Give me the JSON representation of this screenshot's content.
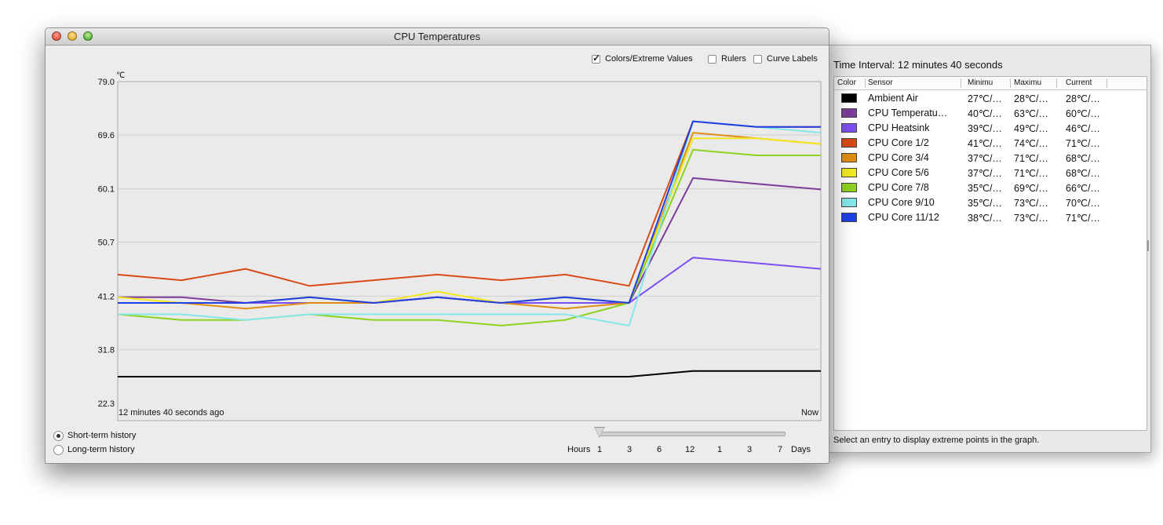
{
  "window": {
    "title": "CPU Temperatures",
    "options": {
      "colors_extreme": {
        "label": "Colors/Extreme Values",
        "checked": true
      },
      "rulers": {
        "label": "Rulers",
        "checked": false
      },
      "curve_labels": {
        "label": "Curve Labels",
        "checked": false
      }
    },
    "history": {
      "short_term": {
        "label": "Short-term history",
        "selected": true
      },
      "long_term": {
        "label": "Long-term history",
        "selected": false
      }
    },
    "slider": {
      "left_label": "Hours",
      "right_label": "Days",
      "ticks": [
        "1",
        "3",
        "6",
        "12",
        "1",
        "3",
        "7"
      ],
      "selected_tick": "1"
    }
  },
  "drawer": {
    "title": "Time Interval: 12 minutes 40 seconds",
    "columns": [
      "Color",
      "Sensor",
      "Minimu",
      "Maximu",
      "Current"
    ],
    "rows": [
      {
        "color": "#000000",
        "sensor": "Ambient Air",
        "min": "27℃/…",
        "max": "28℃/…",
        "current": "28℃/…"
      },
      {
        "color": "#7d3c98",
        "sensor": "CPU Temperatu…",
        "min": "40℃/…",
        "max": "63℃/…",
        "current": "60℃/…"
      },
      {
        "color": "#7b4ff0",
        "sensor": "CPU Heatsink",
        "min": "39℃/…",
        "max": "49℃/…",
        "current": "46℃/…"
      },
      {
        "color": "#d84a16",
        "sensor": "CPU Core 1/2",
        "min": "41℃/…",
        "max": "74℃/…",
        "current": "71℃/…"
      },
      {
        "color": "#df8e12",
        "sensor": "CPU Core 3/4",
        "min": "37℃/…",
        "max": "71℃/…",
        "current": "68℃/…"
      },
      {
        "color": "#f2e81e",
        "sensor": "CPU Core 5/6",
        "min": "37℃/…",
        "max": "71℃/…",
        "current": "68℃/…"
      },
      {
        "color": "#8ed21f",
        "sensor": "CPU Core 7/8",
        "min": "35℃/…",
        "max": "69℃/…",
        "current": "66℃/…"
      },
      {
        "color": "#86e7ea",
        "sensor": "CPU Core 9/10",
        "min": "35℃/…",
        "max": "73℃/…",
        "current": "70℃/…"
      },
      {
        "color": "#1f3fe6",
        "sensor": "CPU Core 11/12",
        "min": "38℃/…",
        "max": "73℃/…",
        "current": "71℃/…"
      }
    ],
    "status": "Select an entry to display extreme points in the graph."
  },
  "chart_data": {
    "type": "line",
    "ylabel": "℃",
    "ylim": [
      22.3,
      79.0
    ],
    "yticks": [
      "79.0",
      "69.6",
      "60.1",
      "50.7",
      "41.2",
      "31.8",
      "22.3"
    ],
    "x_start_label": "12 minutes 40 seconds ago",
    "x_end_label": "Now",
    "x_points": 12,
    "grid": true,
    "series": [
      {
        "name": "Ambient Air",
        "color": "#000000",
        "values": [
          27,
          27,
          27,
          27,
          27,
          27,
          27,
          27,
          27,
          28,
          28,
          28
        ]
      },
      {
        "name": "CPU Temperatu…",
        "color": "#7d3c98",
        "values": [
          41,
          41,
          40,
          41,
          40,
          41,
          40,
          41,
          40,
          62,
          61,
          60
        ]
      },
      {
        "name": "CPU Heatsink",
        "color": "#7b4ff0",
        "values": [
          40,
          40,
          40,
          40,
          40,
          41,
          40,
          40,
          40,
          48,
          47,
          46
        ]
      },
      {
        "name": "CPU Core 1/2",
        "color": "#d84a16",
        "values": [
          45,
          44,
          46,
          43,
          44,
          45,
          44,
          45,
          43,
          72,
          71,
          71
        ]
      },
      {
        "name": "CPU Core 3/4",
        "color": "#df8e12",
        "values": [
          40,
          40,
          39,
          40,
          40,
          41,
          40,
          39,
          40,
          70,
          69,
          68
        ]
      },
      {
        "name": "CPU Core 5/6",
        "color": "#f2e81e",
        "values": [
          41,
          40,
          40,
          41,
          40,
          42,
          40,
          41,
          40,
          69,
          69,
          68
        ]
      },
      {
        "name": "CPU Core 7/8",
        "color": "#8ed21f",
        "values": [
          38,
          37,
          37,
          38,
          37,
          37,
          36,
          37,
          40,
          67,
          66,
          66
        ]
      },
      {
        "name": "CPU Core 9/10",
        "color": "#86e7ea",
        "values": [
          38,
          38,
          37,
          38,
          38,
          38,
          38,
          38,
          36,
          72,
          71,
          70
        ]
      },
      {
        "name": "CPU Core 11/12",
        "color": "#1f3fe6",
        "values": [
          40,
          40,
          40,
          41,
          40,
          41,
          40,
          41,
          40,
          72,
          71,
          71
        ]
      }
    ]
  }
}
